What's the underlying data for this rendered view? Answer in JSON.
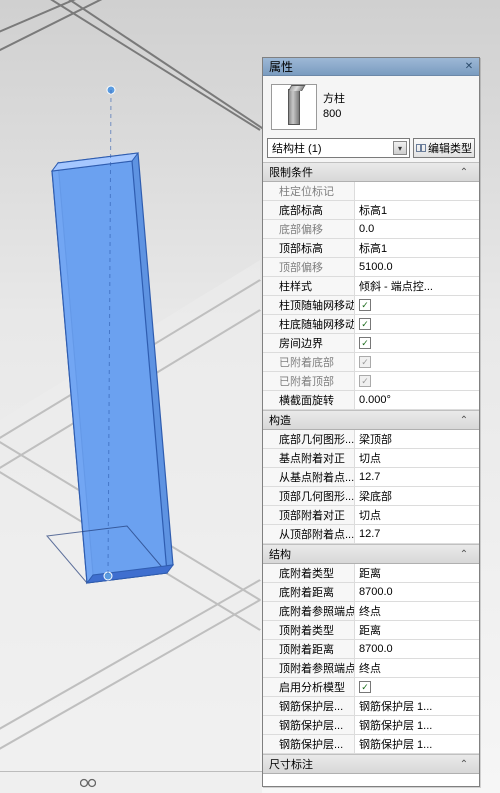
{
  "panel": {
    "title": "属性",
    "type_family": "方柱",
    "type_name": "800",
    "selector_label": "结构柱 (1)",
    "edit_type_label": "编辑类型"
  },
  "groups": [
    {
      "label": "限制条件",
      "rows": [
        {
          "k": "柱定位标记",
          "v": "",
          "gray": true,
          "indent": true
        },
        {
          "k": "底部标高",
          "v": "标高1",
          "indent": true
        },
        {
          "k": "底部偏移",
          "v": "0.0",
          "gray": true,
          "indent": true
        },
        {
          "k": "顶部标高",
          "v": "标高1",
          "indent": true
        },
        {
          "k": "顶部偏移",
          "v": "5100.0",
          "gray": true,
          "indent": true
        },
        {
          "k": "柱样式",
          "v": "倾斜 - 端点控...",
          "indent": true
        },
        {
          "k": "柱顶随轴网移动",
          "check": true,
          "checked": true,
          "indent": true
        },
        {
          "k": "柱底随轴网移动",
          "check": true,
          "checked": true,
          "indent": true
        },
        {
          "k": "房间边界",
          "check": true,
          "checked": true,
          "indent": true
        },
        {
          "k": "已附着底部",
          "check": true,
          "checked": true,
          "gray": true,
          "indent": true
        },
        {
          "k": "已附着顶部",
          "check": true,
          "checked": true,
          "gray": true,
          "indent": true
        },
        {
          "k": "横截面旋转",
          "v": "0.000°",
          "indent": true
        }
      ]
    },
    {
      "label": "构造",
      "rows": [
        {
          "k": "底部几何图形...",
          "v": "梁顶部",
          "indent": true
        },
        {
          "k": "基点附着对正",
          "v": "切点",
          "indent": true
        },
        {
          "k": "从基点附着点...",
          "v": "12.7",
          "indent": true
        },
        {
          "k": "顶部几何图形...",
          "v": "梁底部",
          "indent": true
        },
        {
          "k": "顶部附着对正",
          "v": "切点",
          "indent": true
        },
        {
          "k": "从顶部附着点...",
          "v": "12.7",
          "indent": true
        }
      ]
    },
    {
      "label": "结构",
      "rows": [
        {
          "k": "底附着类型",
          "v": "距离",
          "indent": true
        },
        {
          "k": "底附着距离",
          "v": "8700.0",
          "indent": true
        },
        {
          "k": "底附着参照端点",
          "v": "终点",
          "indent": true
        },
        {
          "k": "顶附着类型",
          "v": "距离",
          "indent": true
        },
        {
          "k": "顶附着距离",
          "v": "8700.0",
          "indent": true
        },
        {
          "k": "顶附着参照端点",
          "v": "终点",
          "indent": true
        },
        {
          "k": "启用分析模型",
          "check": true,
          "checked": true,
          "indent": true
        },
        {
          "k": "钢筋保护层...",
          "v": "钢筋保护层 1...",
          "indent": true
        },
        {
          "k": "钢筋保护层...",
          "v": "钢筋保护层 1...",
          "indent": true
        },
        {
          "k": "钢筋保护层...",
          "v": "钢筋保护层 1...",
          "indent": true
        }
      ]
    },
    {
      "label": "尺寸标注",
      "rows": []
    }
  ]
}
